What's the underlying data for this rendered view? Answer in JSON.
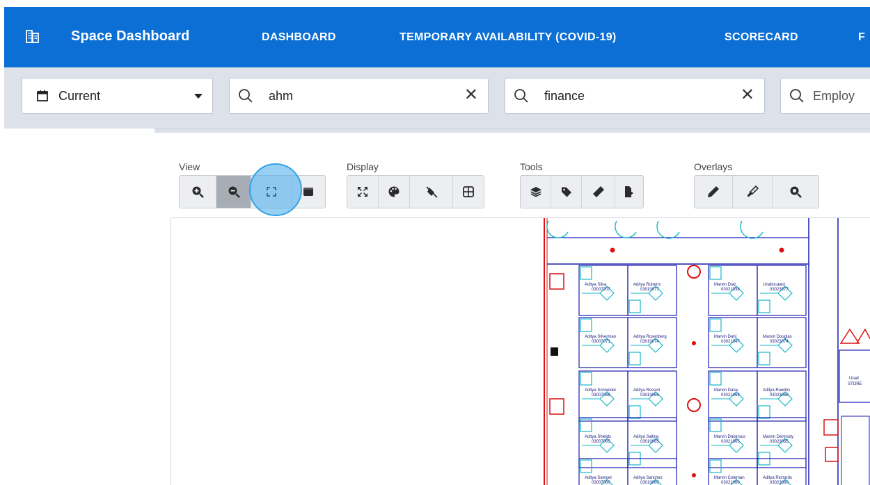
{
  "header": {
    "app_title": "Space Dashboard",
    "nav": [
      "DASHBOARD",
      "TEMPORARY AVAILABILITY (COVID-19)",
      "SCORECARD",
      "F"
    ],
    "brand_icon": "building-icon",
    "bg_color": "#0b6fd6"
  },
  "filters": {
    "period": {
      "icon": "calendar-icon",
      "value": "Current",
      "dropdown_icon": "caret-down-icon"
    },
    "search_1": {
      "icon": "search-icon",
      "value": "ahm",
      "clear_icon": "close-icon"
    },
    "search_2": {
      "icon": "search-icon",
      "value": "finance",
      "clear_icon": "close-icon"
    },
    "search_3": {
      "icon": "search-icon",
      "placeholder": "Employ"
    }
  },
  "toolbar": {
    "view": {
      "label": "View",
      "buttons": [
        "zoom-in-icon",
        "zoom-out-icon",
        "fit-to-screen-icon",
        "panel-icon"
      ]
    },
    "display": {
      "label": "Display",
      "buttons": [
        "expand-icon",
        "palette-icon",
        "hide-fill-icon",
        "grid-icon"
      ]
    },
    "tools": {
      "label": "Tools",
      "buttons": [
        "layers-icon",
        "tag-icon",
        "ruler-icon",
        "export-icon"
      ]
    },
    "overlays": {
      "label": "Overlays",
      "buttons": [
        "pencil-icon",
        "marker-icon",
        "search-zoom-icon"
      ]
    }
  },
  "floorplan": {
    "occupants": [
      {
        "name": "Aditya Silva",
        "id": "03007207"
      },
      {
        "name": "Aditya Roberts",
        "id": "03010077"
      },
      {
        "name": "Marvin Diaz",
        "id": "03021038"
      },
      {
        "name": "Unallocated",
        "id": "03023077"
      },
      {
        "name": "Aditya Silverman",
        "id": "03007071"
      },
      {
        "name": "Aditya Rosenberg",
        "id": "03010074"
      },
      {
        "name": "Marvin Dahl",
        "id": "03021047"
      },
      {
        "name": "Marvin Douglas",
        "id": "03023074"
      },
      {
        "name": "Aditya Schneider",
        "id": "03007068"
      },
      {
        "name": "Aditya Rossini",
        "id": "03010066"
      },
      {
        "name": "Marvin Dana",
        "id": "03021068"
      },
      {
        "name": "Aditya Rawlins",
        "id": "03023068"
      },
      {
        "name": "Aditya Shields",
        "id": "03007065"
      },
      {
        "name": "Aditya Salling",
        "id": "03010065"
      },
      {
        "name": "Marvin Dabinous",
        "id": "03021065"
      },
      {
        "name": "Marvin Dermody",
        "id": "03023065"
      },
      {
        "name": "Aditya Samuel",
        "id": "03007060"
      },
      {
        "name": "Aditya Sanchez",
        "id": "03010060"
      },
      {
        "name": "Marvin Coleman",
        "id": "03021060"
      },
      {
        "name": "Aditya Richards",
        "id": "03023060"
      }
    ],
    "labels": [
      "Unall",
      "STORE"
    ]
  }
}
